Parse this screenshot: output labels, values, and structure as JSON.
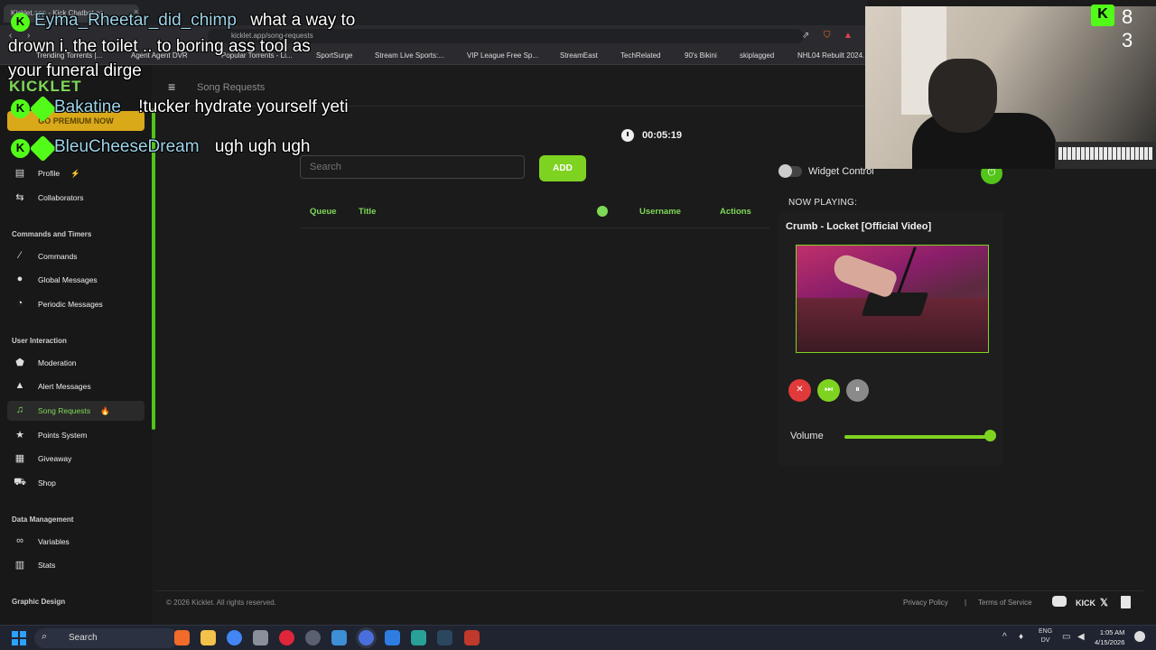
{
  "browser": {
    "tab_title": "Kicklet.app - Kick Chatbot an",
    "tab_close": "×",
    "url": "kicklet.app/song-requests",
    "bookmarks": [
      "Trending Torrents |...",
      "Agent Agent DVR",
      "Popular Torrents - Li...",
      "SportSurge",
      "Stream Live Sports:...",
      "VIP League Free Sp...",
      "StreamEast",
      "TechRelated",
      "90's Bikini",
      "skiplagged",
      "NHL04 Rebuilt 2024..."
    ]
  },
  "sidebar": {
    "logo": "KICKLET",
    "premium": "GO PREMIUM NOW",
    "items": [
      {
        "label": "Profile",
        "icon": "user-id-icon",
        "glyph": "▤"
      },
      {
        "label": "Collaborators",
        "icon": "collaborators-icon",
        "glyph": "⇆"
      },
      {
        "label": "Commands",
        "icon": "wand-icon",
        "glyph": "⁄"
      },
      {
        "label": "Global Messages",
        "icon": "chat-bubble-icon",
        "glyph": "●"
      },
      {
        "label": "Periodic Messages",
        "icon": "clock-icon",
        "glyph": "◔"
      },
      {
        "label": "Moderation",
        "icon": "shield-icon",
        "glyph": "⬟"
      },
      {
        "label": "Alert Messages",
        "icon": "warning-icon",
        "glyph": "▲"
      },
      {
        "label": "Song Requests",
        "icon": "music-note-icon",
        "glyph": "♫"
      },
      {
        "label": "Points System",
        "icon": "star-icon",
        "glyph": "★"
      },
      {
        "label": "Giveaway",
        "icon": "gift-icon",
        "glyph": "▦"
      },
      {
        "label": "Shop",
        "icon": "cart-icon",
        "glyph": "⛟"
      },
      {
        "label": "Variables",
        "icon": "link-icon",
        "glyph": "∞"
      },
      {
        "label": "Stats",
        "icon": "bar-chart-icon",
        "glyph": "▥"
      }
    ],
    "sections": [
      "Commands and Timers",
      "User Interaction",
      "Data Management",
      "Graphic Design"
    ],
    "profile_badge": "⚡",
    "song_badge": "🔥"
  },
  "header": {
    "breadcrumb": "Song Requests",
    "menu_glyph": "≡"
  },
  "main": {
    "timer": "00:05:19",
    "search_placeholder": "Search",
    "add_label": "ADD",
    "columns": [
      "Queue",
      "Title",
      "Username",
      "Actions"
    ]
  },
  "widget": {
    "control_label": "Widget Control",
    "now_playing_label": "NOW PLAYING:",
    "song_title": "Crumb - Locket [Official Video]",
    "volume_label": "Volume",
    "volume_level": 0.98,
    "power_glyph": "⏻",
    "buttons": {
      "stop": "✕",
      "next": "⏭",
      "pause": "⏸"
    },
    "colors": {
      "stop": "#e03a3a",
      "next": "#7ed321",
      "pause": "#8a8a8a"
    }
  },
  "footer": {
    "copyright": "© 2026 Kicklet. All rights reserved.",
    "privacy": "Privacy Policy",
    "separator": "|",
    "terms": "Terms of Service",
    "kick": "KICK",
    "x": "𝕏"
  },
  "stream_overlay": {
    "viewer_count": "8 3",
    "chat": [
      {
        "user": "Eyma_Rheetar_did_chimp",
        "message_lines": [
          "what a way to",
          "drown i. the toilet .. to boring ass tool as",
          "your funeral dirge"
        ]
      },
      {
        "user": "Bakatine",
        "message": "!tucker hydrate yourself yeti"
      },
      {
        "user": "BleuCheeseDream",
        "message": "ugh ugh ugh"
      }
    ]
  },
  "taskbar": {
    "search": "Search",
    "lang_top": "ENG",
    "lang_bottom": "DV",
    "time": "1:05 AM",
    "date": "4/15/2026"
  },
  "accent_color": "#7ed957"
}
